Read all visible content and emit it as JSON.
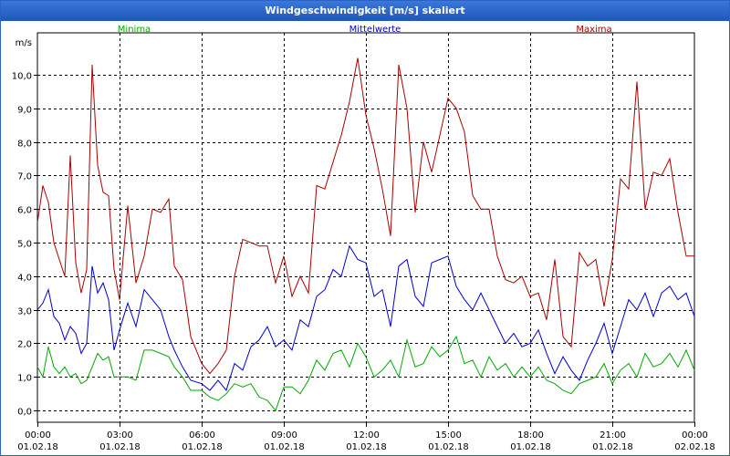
{
  "window": {
    "title": "Windgeschwindigkeit [m/s] skaliert"
  },
  "chart_data": {
    "type": "line",
    "title": "Windgeschwindigkeit [m/s] skaliert",
    "ylabel": "m/s",
    "ylim": [
      -0.35,
      11.25
    ],
    "xlim": [
      0,
      24
    ],
    "grid": true,
    "legend": "top",
    "yticks": [
      "0,0",
      "1,0",
      "2,0",
      "3,0",
      "4,0",
      "5,0",
      "6,0",
      "7,0",
      "8,0",
      "9,0",
      "10,0"
    ],
    "xticks": [
      {
        "time": "00:00",
        "date": "01.02.18"
      },
      {
        "time": "03:00",
        "date": "01.02.18"
      },
      {
        "time": "06:00",
        "date": "01.02.18"
      },
      {
        "time": "09:00",
        "date": "01.02.18"
      },
      {
        "time": "12:00",
        "date": "01.02.18"
      },
      {
        "time": "15:00",
        "date": "01.02.18"
      },
      {
        "time": "18:00",
        "date": "01.02.18"
      },
      {
        "time": "21:00",
        "date": "01.02.18"
      },
      {
        "time": "00:00",
        "date": "02.02.18"
      }
    ],
    "series": [
      {
        "name": "Minima",
        "color": "#00aa00",
        "x": [
          0,
          0.2,
          0.4,
          0.6,
          0.8,
          1,
          1.2,
          1.4,
          1.6,
          1.8,
          2,
          2.2,
          2.4,
          2.6,
          2.8,
          3,
          3.3,
          3.6,
          3.9,
          4.2,
          4.5,
          4.8,
          5,
          5.3,
          5.6,
          6,
          6.3,
          6.6,
          6.9,
          7.2,
          7.5,
          7.8,
          8.1,
          8.4,
          8.7,
          9,
          9.3,
          9.6,
          9.9,
          10.2,
          10.5,
          10.8,
          11.1,
          11.4,
          11.7,
          12,
          12.3,
          12.6,
          12.9,
          13.2,
          13.5,
          13.8,
          14.1,
          14.4,
          14.7,
          15,
          15.3,
          15.6,
          15.9,
          16.2,
          16.5,
          16.8,
          17.1,
          17.4,
          17.7,
          18,
          18.3,
          18.6,
          18.9,
          19.2,
          19.5,
          19.8,
          20.1,
          20.4,
          20.7,
          21,
          21.3,
          21.6,
          21.9,
          22.2,
          22.5,
          22.8,
          23.1,
          23.4,
          23.7,
          24
        ],
        "values": [
          1.3,
          1.0,
          1.9,
          1.3,
          1.1,
          1.3,
          1.0,
          1.1,
          0.8,
          0.9,
          1.3,
          1.7,
          1.5,
          1.6,
          1.0,
          1.0,
          1.0,
          0.9,
          1.8,
          1.8,
          1.7,
          1.6,
          1.3,
          1.0,
          0.6,
          0.6,
          0.4,
          0.3,
          0.5,
          0.8,
          0.7,
          0.8,
          0.4,
          0.3,
          0.0,
          0.7,
          0.7,
          0.5,
          0.9,
          1.5,
          1.2,
          1.7,
          1.8,
          1.3,
          2.0,
          1.6,
          1.0,
          1.2,
          1.5,
          1.0,
          2.1,
          1.3,
          1.4,
          1.9,
          1.6,
          1.8,
          2.2,
          1.4,
          1.5,
          1.0,
          1.6,
          1.2,
          1.4,
          1.0,
          1.3,
          1.0,
          1.3,
          0.9,
          0.8,
          0.6,
          0.5,
          0.8,
          0.9,
          1.0,
          1.4,
          0.8,
          1.2,
          1.4,
          1.0,
          1.7,
          1.3,
          1.4,
          1.7,
          1.3,
          1.8,
          1.2
        ]
      },
      {
        "name": "Mittelwerte",
        "color": "#0000cc",
        "x": [
          0,
          0.2,
          0.4,
          0.6,
          0.8,
          1,
          1.2,
          1.4,
          1.6,
          1.8,
          2,
          2.2,
          2.4,
          2.6,
          2.8,
          3,
          3.3,
          3.6,
          3.9,
          4.2,
          4.5,
          4.8,
          5,
          5.3,
          5.6,
          6,
          6.3,
          6.6,
          6.9,
          7.2,
          7.5,
          7.8,
          8.1,
          8.4,
          8.7,
          9,
          9.3,
          9.6,
          9.9,
          10.2,
          10.5,
          10.8,
          11.1,
          11.4,
          11.7,
          12,
          12.3,
          12.6,
          12.9,
          13.2,
          13.5,
          13.8,
          14.1,
          14.4,
          14.7,
          15,
          15.3,
          15.6,
          15.9,
          16.2,
          16.5,
          16.8,
          17.1,
          17.4,
          17.7,
          18,
          18.3,
          18.6,
          18.9,
          19.2,
          19.5,
          19.8,
          20.1,
          20.4,
          20.7,
          21,
          21.3,
          21.6,
          21.9,
          22.2,
          22.5,
          22.8,
          23.1,
          23.4,
          23.7,
          24
        ],
        "values": [
          3.0,
          3.2,
          3.6,
          2.8,
          2.6,
          2.1,
          2.5,
          2.3,
          1.7,
          2.0,
          4.3,
          3.5,
          3.8,
          3.3,
          1.8,
          2.4,
          3.2,
          2.5,
          3.6,
          3.3,
          3.0,
          2.2,
          1.8,
          1.3,
          0.9,
          0.8,
          0.6,
          0.9,
          0.6,
          1.4,
          1.2,
          1.9,
          2.1,
          2.5,
          1.9,
          2.1,
          1.8,
          2.7,
          2.5,
          3.4,
          3.6,
          4.2,
          4.0,
          4.9,
          4.5,
          4.4,
          3.4,
          3.6,
          2.5,
          4.3,
          4.5,
          3.4,
          3.1,
          4.4,
          4.5,
          4.6,
          3.7,
          3.3,
          3.0,
          3.5,
          3.0,
          2.5,
          2.0,
          2.3,
          1.9,
          2.0,
          2.4,
          1.7,
          1.1,
          1.6,
          1.2,
          0.9,
          1.5,
          2.0,
          2.6,
          1.7,
          2.5,
          3.3,
          3.0,
          3.5,
          2.8,
          3.5,
          3.7,
          3.3,
          3.5,
          2.8
        ]
      },
      {
        "name": "Maxima",
        "color": "#aa0000",
        "x": [
          0,
          0.2,
          0.4,
          0.6,
          0.8,
          1,
          1.2,
          1.4,
          1.6,
          1.8,
          2,
          2.2,
          2.4,
          2.6,
          2.8,
          3,
          3.3,
          3.6,
          3.9,
          4.2,
          4.5,
          4.8,
          5,
          5.3,
          5.6,
          6,
          6.3,
          6.6,
          6.9,
          7.2,
          7.5,
          7.8,
          8.1,
          8.4,
          8.7,
          9,
          9.3,
          9.6,
          9.9,
          10.2,
          10.5,
          10.8,
          11.1,
          11.4,
          11.7,
          12,
          12.3,
          12.6,
          12.9,
          13.2,
          13.5,
          13.8,
          14.1,
          14.4,
          14.7,
          15,
          15.3,
          15.6,
          15.9,
          16.2,
          16.5,
          16.8,
          17.1,
          17.4,
          17.7,
          18,
          18.3,
          18.6,
          18.9,
          19.2,
          19.5,
          19.8,
          20.1,
          20.4,
          20.7,
          21,
          21.3,
          21.6,
          21.9,
          22.2,
          22.5,
          22.8,
          23.1,
          23.4,
          23.7,
          24
        ],
        "values": [
          5.6,
          6.7,
          6.2,
          5.0,
          4.5,
          4.0,
          7.6,
          4.4,
          3.5,
          4.2,
          10.3,
          7.3,
          6.5,
          6.4,
          4.2,
          3.3,
          6.1,
          3.8,
          4.6,
          6.0,
          5.9,
          6.3,
          4.3,
          3.9,
          2.2,
          1.4,
          1.1,
          1.4,
          1.8,
          4.0,
          5.1,
          5.0,
          4.9,
          4.9,
          3.8,
          4.6,
          3.4,
          4.0,
          3.5,
          6.7,
          6.6,
          7.4,
          8.2,
          9.2,
          10.5,
          8.8,
          7.8,
          6.6,
          5.2,
          10.3,
          9.0,
          5.9,
          8.0,
          7.1,
          8.2,
          9.3,
          9.0,
          8.3,
          6.4,
          6.0,
          6.0,
          4.6,
          3.9,
          3.8,
          4.0,
          3.4,
          3.5,
          2.7,
          4.5,
          2.2,
          1.9,
          4.7,
          4.3,
          4.5,
          3.1,
          4.5,
          6.9,
          6.6,
          9.8,
          6.0,
          7.1,
          7.0,
          7.5,
          5.9,
          4.6,
          4.6
        ]
      }
    ]
  }
}
